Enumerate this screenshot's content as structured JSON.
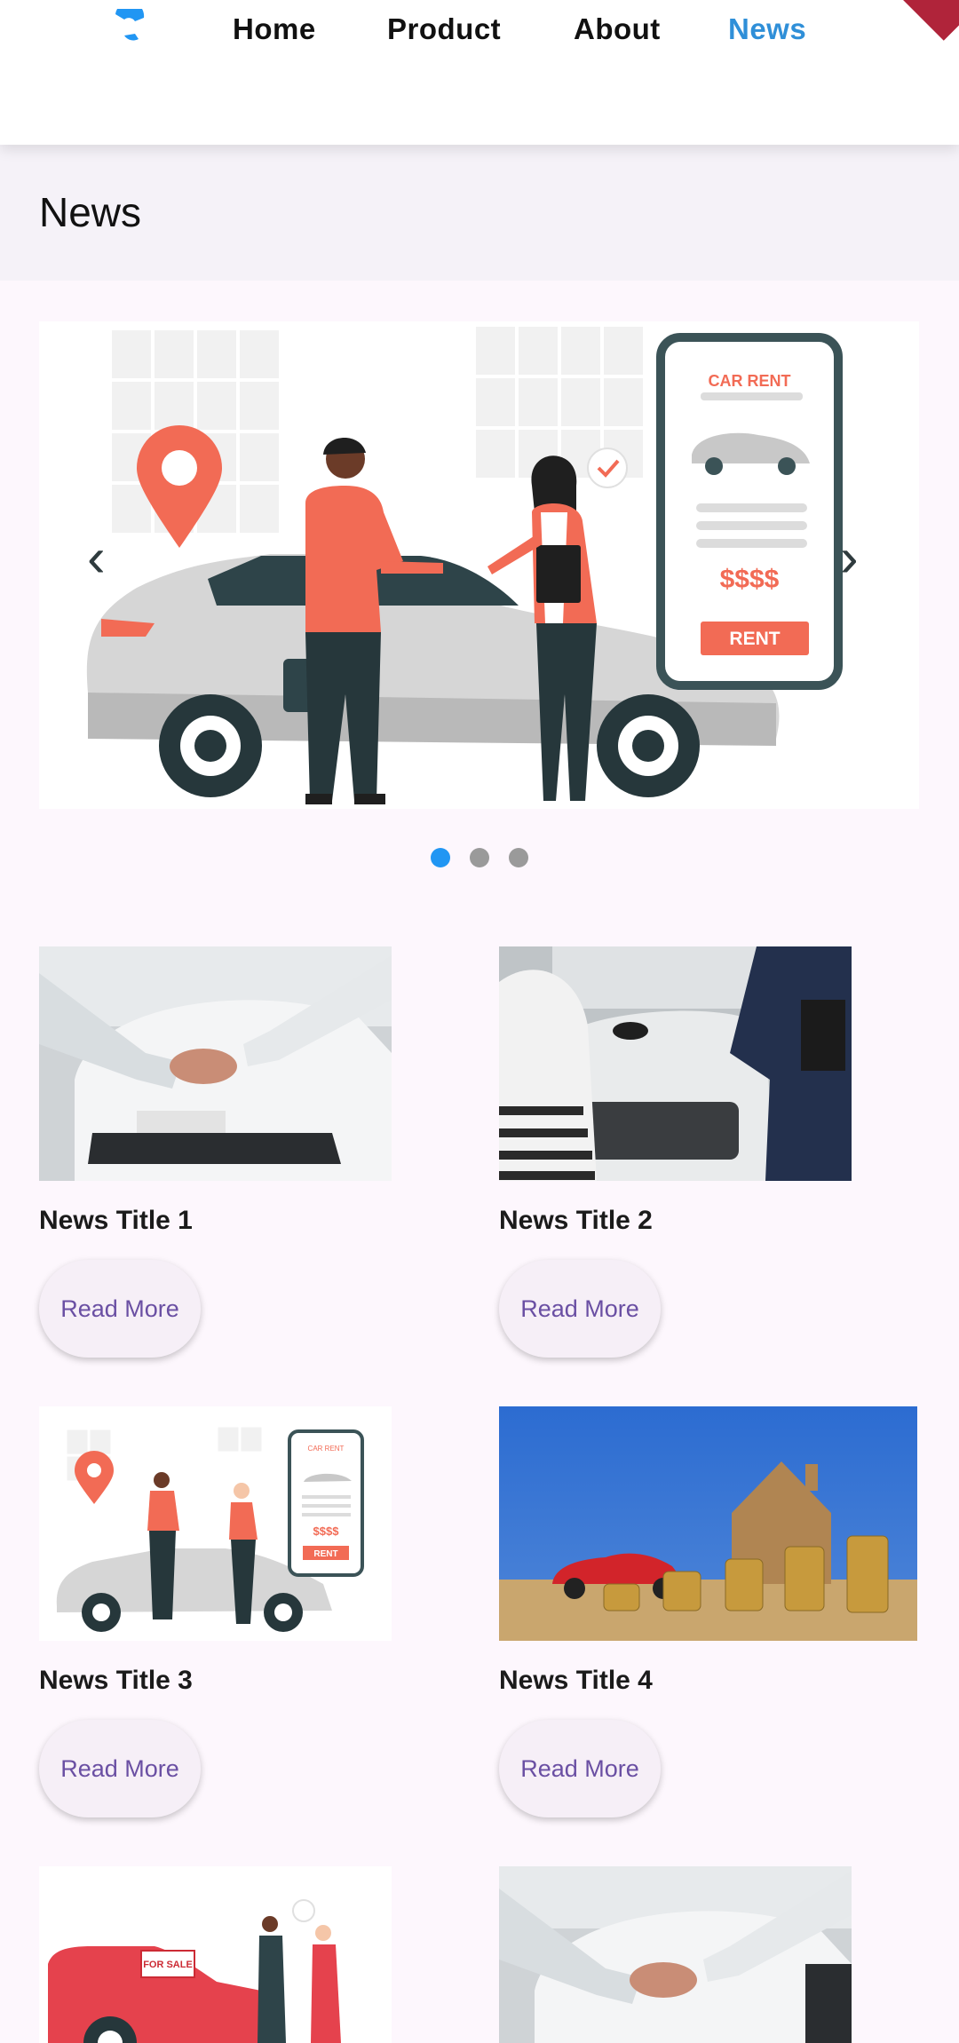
{
  "nav": {
    "items": [
      {
        "label": "Home",
        "active": false
      },
      {
        "label": "Product",
        "active": false
      },
      {
        "label": "About",
        "active": false
      },
      {
        "label": "News",
        "active": true
      }
    ]
  },
  "page": {
    "title": "News"
  },
  "carousel": {
    "slide_count": 3,
    "active_index": 0,
    "slide_text": {
      "brand": "CAR RENT",
      "price": "$$$$",
      "button": "RENT"
    }
  },
  "news": [
    {
      "title": "News Title 1",
      "button": "Read More"
    },
    {
      "title": "News Title 2",
      "button": "Read More"
    },
    {
      "title": "News Title 3",
      "button": "Read More"
    },
    {
      "title": "News Title 4",
      "button": "Read More"
    },
    {
      "title": "",
      "button": ""
    },
    {
      "title": "",
      "button": ""
    }
  ],
  "thumb_text": {
    "rent": "RENT",
    "price": "$$$$",
    "for_sale": "FOR SALE"
  },
  "colors": {
    "accent": "#2196f3",
    "nav_active": "#2f8fd8",
    "button_text": "#6a4fa3",
    "illustration_coral": "#f26b55"
  }
}
